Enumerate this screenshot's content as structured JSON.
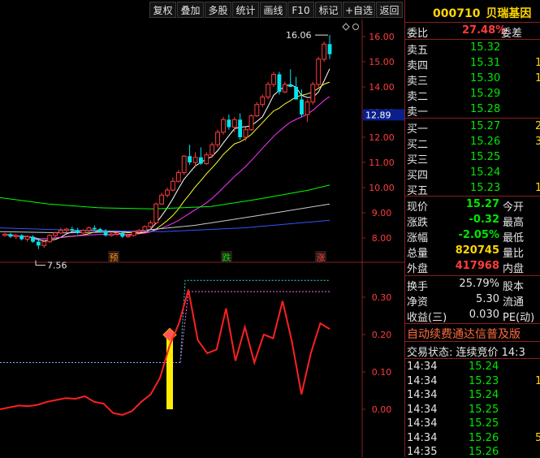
{
  "toolbar": {
    "buttons": [
      "复权",
      "叠加",
      "多股",
      "统计",
      "画线",
      "F10",
      "标记",
      "+自选",
      "返回"
    ]
  },
  "chart": {
    "price_axis": [
      "16.00",
      "15.00",
      "14.00",
      "13.00",
      "12.00",
      "11.00",
      "10.00",
      "9.00",
      "8.00"
    ],
    "current_price_tag": "12.89",
    "high_label": "16.06",
    "low_label": "7.56",
    "signals": [
      {
        "text": "预",
        "color": "#ff8c00"
      },
      {
        "text": "跌",
        "color": "#00e600"
      },
      {
        "text": "涨",
        "color": "#ff3c3c"
      }
    ],
    "indicator_axis": [
      "0.30",
      "0.20",
      "0.10",
      "0.00"
    ],
    "colors": {
      "up": "#ff3c3c",
      "down": "#00e5ee",
      "ma5": "#ffffff",
      "ma10": "#ffff33",
      "ma20": "#ff33ff",
      "ma60": "#00ff00",
      "ma120": "#cccccc",
      "ma250": "#3355ff",
      "axis": "#8a1f1f"
    }
  },
  "chart_data": {
    "type": "candlestick",
    "candles": [
      [
        8.1,
        8.2,
        8.05,
        8.15
      ],
      [
        8.15,
        8.2,
        8.0,
        8.05
      ],
      [
        8.05,
        8.15,
        7.95,
        8.1
      ],
      [
        8.1,
        8.15,
        7.9,
        7.95
      ],
      [
        7.95,
        8.1,
        7.85,
        8.05
      ],
      [
        8.05,
        8.1,
        7.8,
        7.85
      ],
      [
        7.85,
        8.0,
        7.56,
        7.7
      ],
      [
        7.7,
        7.9,
        7.6,
        7.85
      ],
      [
        7.85,
        8.15,
        7.8,
        8.1
      ],
      [
        8.1,
        8.25,
        8.0,
        8.2
      ],
      [
        8.2,
        8.4,
        8.15,
        8.3
      ],
      [
        8.3,
        8.4,
        8.2,
        8.35
      ],
      [
        8.35,
        8.45,
        8.25,
        8.3
      ],
      [
        8.3,
        8.4,
        8.15,
        8.2
      ],
      [
        8.2,
        8.35,
        8.1,
        8.3
      ],
      [
        8.3,
        8.45,
        8.25,
        8.4
      ],
      [
        8.4,
        8.5,
        8.3,
        8.35
      ],
      [
        8.35,
        8.4,
        8.2,
        8.25
      ],
      [
        8.25,
        8.35,
        8.05,
        8.1
      ],
      [
        8.1,
        8.2,
        8.05,
        8.15
      ],
      [
        8.15,
        8.25,
        8.1,
        8.2
      ],
      [
        8.2,
        8.25,
        8.0,
        8.05
      ],
      [
        8.05,
        8.15,
        8.0,
        8.1
      ],
      [
        8.1,
        8.3,
        8.05,
        8.25
      ],
      [
        8.25,
        8.35,
        8.2,
        8.3
      ],
      [
        8.3,
        8.5,
        8.25,
        8.45
      ],
      [
        8.45,
        8.7,
        8.4,
        8.6
      ],
      [
        8.6,
        9.4,
        8.55,
        9.35
      ],
      [
        9.35,
        9.8,
        9.3,
        9.7
      ],
      [
        9.7,
        10.0,
        9.6,
        9.9
      ],
      [
        9.9,
        10.4,
        9.85,
        10.25
      ],
      [
        10.25,
        10.7,
        10.2,
        10.6
      ],
      [
        10.6,
        11.3,
        10.5,
        11.25
      ],
      [
        11.25,
        11.7,
        10.9,
        11.0
      ],
      [
        11.0,
        11.4,
        10.8,
        11.2
      ],
      [
        11.2,
        11.6,
        10.9,
        10.95
      ],
      [
        10.95,
        11.4,
        10.9,
        11.3
      ],
      [
        11.3,
        11.8,
        11.2,
        11.7
      ],
      [
        11.7,
        12.3,
        11.6,
        12.2
      ],
      [
        12.2,
        12.8,
        12.1,
        12.7
      ],
      [
        12.7,
        12.9,
        12.3,
        12.4
      ],
      [
        12.4,
        12.8,
        12.2,
        12.7
      ],
      [
        12.7,
        12.95,
        11.9,
        12.0
      ],
      [
        12.0,
        12.4,
        11.85,
        12.3
      ],
      [
        12.3,
        12.9,
        12.25,
        12.85
      ],
      [
        12.85,
        13.4,
        12.8,
        13.3
      ],
      [
        13.3,
        13.7,
        13.2,
        13.6
      ],
      [
        13.6,
        14.2,
        13.5,
        14.1
      ],
      [
        14.1,
        14.6,
        14.0,
        14.5
      ],
      [
        14.5,
        14.6,
        13.7,
        13.8
      ],
      [
        13.8,
        14.2,
        13.75,
        14.1
      ],
      [
        14.1,
        14.7,
        14.0,
        14.0
      ],
      [
        14.0,
        14.4,
        13.5,
        13.5
      ],
      [
        13.5,
        13.9,
        12.8,
        12.9
      ],
      [
        12.9,
        13.5,
        12.6,
        13.4
      ],
      [
        13.4,
        14.2,
        13.3,
        14.1
      ],
      [
        14.1,
        15.2,
        14.0,
        15.1
      ],
      [
        15.1,
        15.8,
        15.0,
        15.7
      ],
      [
        15.7,
        16.06,
        15.1,
        15.3
      ]
    ],
    "indicator": {
      "values": [
        0.0,
        0.005,
        0.01,
        0.008,
        0.012,
        0.02,
        0.025,
        0.03,
        0.028,
        0.035,
        0.02,
        0.015,
        -0.01,
        -0.015,
        -0.005,
        0.02,
        0.04,
        0.085,
        0.17,
        0.23,
        0.32,
        0.185,
        0.15,
        0.16,
        0.27,
        0.13,
        0.22,
        0.125,
        0.2,
        0.19,
        0.29,
        0.18,
        0.04,
        0.15,
        0.23,
        0.215
      ],
      "ref_lines": [
        0.125,
        0.345,
        0.315
      ],
      "bar_value": 0.195
    }
  },
  "panel": {
    "code": "000710",
    "name": "贝瑞基因",
    "weibi_label": "委比",
    "weibi_value": "27.48%",
    "weicha_label": "委差",
    "asks": [
      {
        "label": "卖五",
        "price": "15.32",
        "vol": ""
      },
      {
        "label": "卖四",
        "price": "15.31",
        "vol": "1"
      },
      {
        "label": "卖三",
        "price": "15.30",
        "vol": "1"
      },
      {
        "label": "卖二",
        "price": "15.29",
        "vol": ""
      },
      {
        "label": "卖一",
        "price": "15.28",
        "vol": ""
      }
    ],
    "bids": [
      {
        "label": "买一",
        "price": "15.27",
        "vol": "2"
      },
      {
        "label": "买二",
        "price": "15.26",
        "vol": "3"
      },
      {
        "label": "买三",
        "price": "15.25",
        "vol": ""
      },
      {
        "label": "买四",
        "price": "15.24",
        "vol": ""
      },
      {
        "label": "买五",
        "price": "15.23",
        "vol": "1"
      }
    ],
    "stats": [
      {
        "label": "现价",
        "value": "15.27",
        "color": "#00e600",
        "label2": "今开"
      },
      {
        "label": "涨跌",
        "value": "-0.32",
        "color": "#00e600",
        "label2": "最高"
      },
      {
        "label": "涨幅",
        "value": "-2.05%",
        "color": "#00e600",
        "label2": "最低"
      },
      {
        "label": "总量",
        "value": "820745",
        "color": "#ffd700",
        "label2": "量比"
      },
      {
        "label": "外盘",
        "value": "417968",
        "color": "#ff3c3c",
        "label2": "内盘"
      }
    ],
    "stats2": [
      {
        "label": "换手",
        "value": "25.79%",
        "label2": "股本"
      },
      {
        "label": "净资",
        "value": "5.30",
        "label2": "流通"
      },
      {
        "label": "收益(三)",
        "value": "0.030",
        "label2": "PE(动)"
      }
    ],
    "ticker": "自动续费通达信普及版",
    "status": "交易状态: 连续竞价 14:3",
    "ticks": [
      {
        "time": "14:34",
        "price": "15.24",
        "vol": ""
      },
      {
        "time": "14:34",
        "price": "15.23",
        "vol": "1"
      },
      {
        "time": "14:34",
        "price": "15.24",
        "vol": ""
      },
      {
        "time": "14:34",
        "price": "15.25",
        "vol": ""
      },
      {
        "time": "14:34",
        "price": "15.25",
        "vol": ""
      },
      {
        "time": "14:34",
        "price": "15.26",
        "vol": "5"
      },
      {
        "time": "14:35",
        "price": "15.26",
        "vol": ""
      }
    ]
  }
}
